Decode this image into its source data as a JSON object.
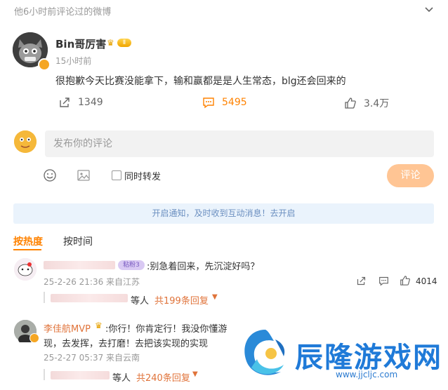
{
  "topbar": {
    "label": "他6小时前评论过的微博"
  },
  "post": {
    "author": "Bin哥厉害",
    "level_badge": "Ⅱ",
    "time": "15小时前",
    "content": "很抱歉今天比赛没能拿下，输和赢都是是人生常态，blg还会回来的",
    "reposts": "1349",
    "comments": "5495",
    "likes": "3.4万"
  },
  "composer": {
    "placeholder": "发布你的评论",
    "repost_label": "同时转发",
    "submit_label": "评论"
  },
  "notice": {
    "text": "开启通知，及时收到互动消息！去开启"
  },
  "sort": {
    "hot": "按热度",
    "time": "按时间"
  },
  "comments": [
    {
      "badge": "粘粉3",
      "text": ":别急着回来，先沉淀好吗？",
      "time": "25-2-26 21:36 来自江苏",
      "likes": "4014",
      "reply_suffix": "等人",
      "reply_count": "共199条回复"
    },
    {
      "author": "李佳航MVP",
      "text": ":你行！你肯定行！我没你懂游",
      "text2": "现，去发挥，去打磨！去把该实现的实现",
      "time": "25-2-27 05:37 来自云南",
      "reply_suffix": "等人",
      "reply_count": "共240条回复"
    }
  ],
  "watermark": {
    "text": "辰隆游戏网",
    "url": "www.jjcljc.com"
  },
  "colors": {
    "accent": "#ff8200",
    "notice_bg": "#eaf3fc",
    "submit_bg": "#ffc594"
  }
}
